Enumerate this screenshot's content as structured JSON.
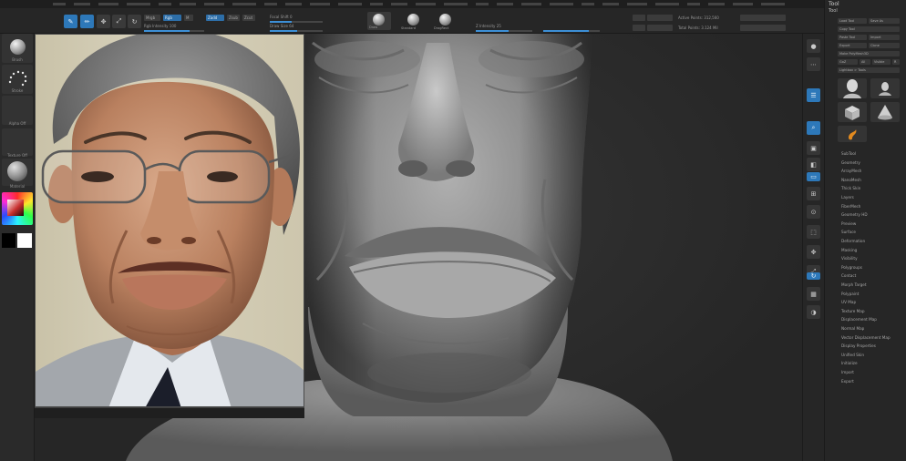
{
  "toolbar": {
    "sphere_labels": [
      "Draw",
      "Standard",
      "DragRect"
    ],
    "field_labels": [
      "Rgb Intensity 100",
      "Draw Size 64",
      "Z Intensity 25",
      "Focal Shift 0",
      "Active Points: 312,560",
      "Total Points: 3.124 Mil",
      "Zadd",
      "Zsub",
      "Zcut",
      "Mrgb",
      "Rgb",
      "M"
    ]
  },
  "left_tray": {
    "captions": [
      "Brush",
      "Stroke",
      "Alpha Off",
      "Texture Off",
      "Material"
    ]
  },
  "palette": {
    "title": "Tool",
    "sub": "Tool",
    "buttons": [
      "Load Tool",
      "Save As",
      "Copy Tool",
      "Paste Tool",
      "Import",
      "Export",
      "Clone",
      "Make PolyMesh3D",
      "GoZ",
      "All",
      "Visible",
      "R",
      "Lightbox > Tools"
    ],
    "subpalettes": [
      "SubTool",
      "Geometry",
      "ArrayMesh",
      "NanoMesh",
      "Thick Skin",
      "Layers",
      "FiberMesh",
      "Geometry HD",
      "Preview",
      "Surface",
      "Deformation",
      "Masking",
      "Visibility",
      "Polygroups",
      "Contact",
      "Morph Target",
      "Polypaint",
      "UV Map",
      "Texture Map",
      "Displacement Map",
      "Normal Map",
      "Vector Displacement Map",
      "Display Properties",
      "Unified Skin",
      "Initialize",
      "Import",
      "Export"
    ]
  },
  "colors": {
    "accent_blue": "#2d78b9",
    "panel_bg": "#262626",
    "viewport_bg": "#2b2b2b",
    "clay": "#9a9a9a"
  }
}
